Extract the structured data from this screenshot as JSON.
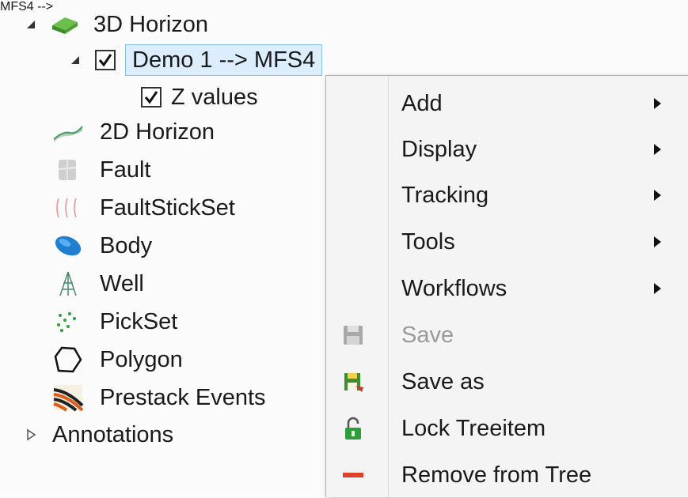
{
  "tree": {
    "items": [
      {
        "label": "3D Horizon",
        "icon": "3d-horizon-icon",
        "expanded": true
      },
      {
        "label": "Demo 1 --> MFS4",
        "checked": true,
        "selected": true
      },
      {
        "label": "Z values",
        "checked": true
      },
      {
        "label": "2D Horizon",
        "icon": "2d-horizon-icon"
      },
      {
        "label": "Fault",
        "icon": "fault-icon"
      },
      {
        "label": "FaultStickSet",
        "icon": "faultstickset-icon"
      },
      {
        "label": "Body",
        "icon": "body-icon"
      },
      {
        "label": "Well",
        "icon": "well-icon"
      },
      {
        "label": "PickSet",
        "icon": "pickset-icon"
      },
      {
        "label": "Polygon",
        "icon": "polygon-icon"
      },
      {
        "label": "Prestack Events",
        "icon": "prestack-events-icon"
      },
      {
        "label": "Annotations",
        "expanded": false
      }
    ]
  },
  "context_menu": {
    "items": [
      {
        "label": "Add",
        "submenu": true
      },
      {
        "label": "Display",
        "submenu": true
      },
      {
        "label": "Tracking",
        "submenu": true
      },
      {
        "label": "Tools",
        "submenu": true
      },
      {
        "label": "Workflows",
        "submenu": true
      },
      {
        "label": "Save",
        "icon": "save-icon",
        "disabled": true
      },
      {
        "label": "Save as",
        "icon": "save-as-icon"
      },
      {
        "label": "Lock Treeitem",
        "icon": "lock-icon"
      },
      {
        "label": "Remove from Tree",
        "icon": "remove-icon"
      }
    ]
  }
}
